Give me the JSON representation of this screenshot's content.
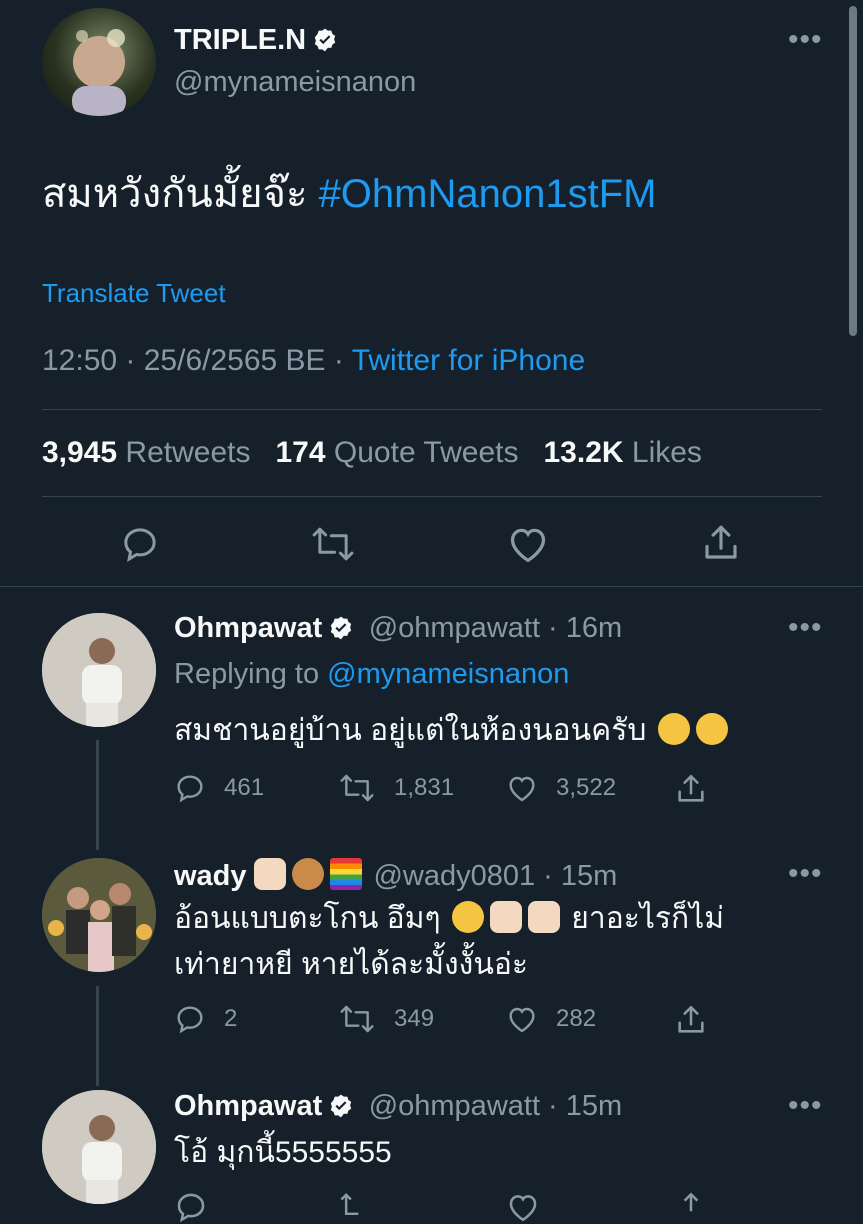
{
  "main_tweet": {
    "author_name": "TRIPLE.N",
    "author_handle": "@mynameisnanon",
    "text": "สมหวังกันมั้ยจ๊ะ",
    "hashtag": "#OhmNanon1stFM",
    "translate_label": "Translate Tweet",
    "time": "12:50",
    "date": "25/6/2565 BE",
    "source": "Twitter for iPhone",
    "stats": {
      "retweets_count": "3,945",
      "retweets_label": "Retweets",
      "quotes_count": "174",
      "quotes_label": "Quote Tweets",
      "likes_count": "13.2K",
      "likes_label": "Likes"
    }
  },
  "replies": [
    {
      "author_name": "Ohmpawat",
      "author_handle": "@ohmpawatt",
      "time": "16m",
      "replying_prefix": "Replying to",
      "replying_to": "@mynameisnanon",
      "text": "สมชานอยู่บ้าน อยู่แต่ในห้องนอนครับ",
      "emoji": [
        "loudly-crying-face",
        "loudly-crying-face"
      ],
      "replies_count": "461",
      "retweets_count": "1,831",
      "likes_count": "3,522"
    },
    {
      "author_name": "wady",
      "name_emoji": [
        "rock-on-hand",
        "dog-face",
        "rainbow-flag"
      ],
      "author_handle": "@wady0801",
      "time": "15m",
      "text_part1": "อ้อนแบบตะโกน อึมๆ",
      "text_emoji": [
        "pensive-face",
        "victory-hand",
        "victory-hand"
      ],
      "text_part2": "ยาอะไรก็ไม่",
      "text_line2": "เท่ายาหยี หายได้ละมั้งงั้นอ่ะ",
      "replies_count": "2",
      "retweets_count": "349",
      "likes_count": "282"
    },
    {
      "author_name": "Ohmpawat",
      "author_handle": "@ohmpawatt",
      "time": "15m",
      "text": "โอ้ มุกนี้5555555"
    }
  ],
  "colors": {
    "background": "#15202b",
    "link": "#1d9bf0",
    "muted": "#8b98a5",
    "divider": "#38444d"
  }
}
